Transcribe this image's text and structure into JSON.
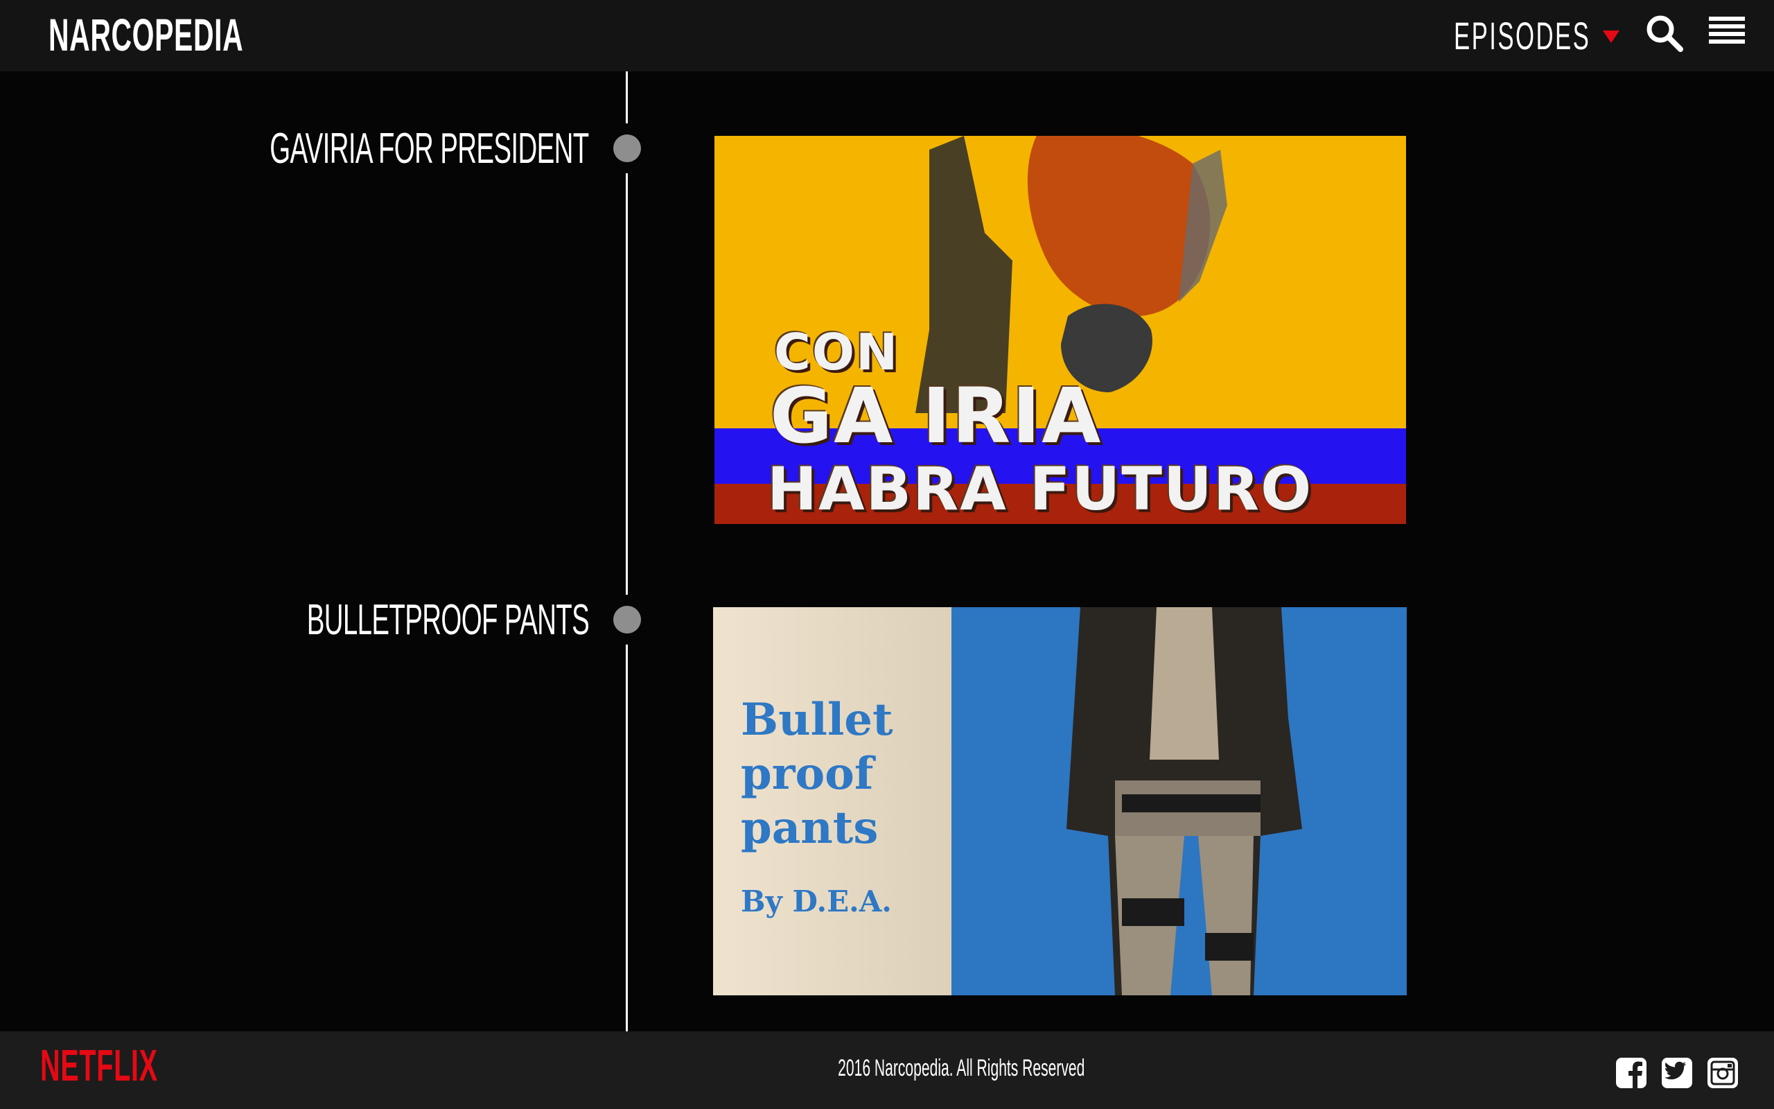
{
  "header": {
    "logo": "NARCOPEDIA",
    "episodes_label": "EPISODES"
  },
  "timeline": {
    "entries": [
      {
        "title": "GAVIRIA FOR PRESIDENT",
        "image_text": {
          "line1": "CON",
          "line2": "GA  IRIA",
          "line3": "HABRA FUTURO"
        }
      },
      {
        "title": "BULLETPROOF PANTS",
        "image_text": {
          "line1": "Bullet",
          "line2": "proof",
          "line3": "pants",
          "line4": "By D.E.A."
        }
      }
    ]
  },
  "footer": {
    "brand": "NETFLIX",
    "copyright": "2016 Narcopedia. All Rights Reserved"
  },
  "colors": {
    "accent": "#e50914",
    "header_bg": "#141414",
    "footer_bg": "#1c1c1c"
  }
}
